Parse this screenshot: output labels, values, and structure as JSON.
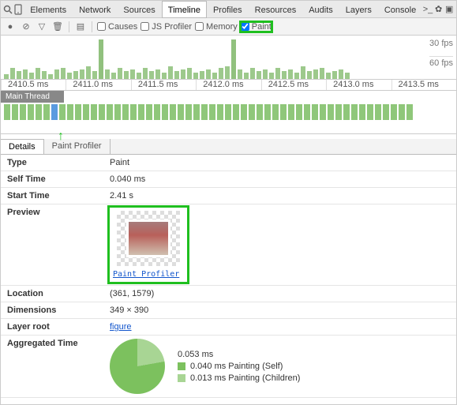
{
  "top_tabs": [
    "Elements",
    "Network",
    "Sources",
    "Timeline",
    "Profiles",
    "Resources",
    "Audits",
    "Layers",
    "Console"
  ],
  "active_top_tab": "Timeline",
  "toolbar": {
    "causes": "Causes",
    "js_profiler": "JS Profiler",
    "memory": "Memory",
    "paint": "Paint"
  },
  "overview": {
    "fps30": "30 fps",
    "fps60": "60 fps",
    "ticks": [
      "2410.5 ms",
      "2411.0 ms",
      "2411.5 ms",
      "2412.0 ms",
      "2412.5 ms",
      "2413.0 ms",
      "2413.5 ms"
    ]
  },
  "main_thread_label": "Main Thread",
  "sub_tabs": {
    "details": "Details",
    "paint_profiler": "Paint Profiler"
  },
  "details": {
    "type_label": "Type",
    "type_value": "Paint",
    "self_time_label": "Self Time",
    "self_time_value": "0.040 ms",
    "start_time_label": "Start Time",
    "start_time_value": "2.41 s",
    "preview_label": "Preview",
    "preview_link": "Paint Profiler",
    "location_label": "Location",
    "location_value": "(361, 1579)",
    "dimensions_label": "Dimensions",
    "dimensions_value": "349 × 390",
    "layer_root_label": "Layer root",
    "layer_root_value": "figure",
    "agg_label": "Aggregated Time"
  },
  "agg": {
    "total": "0.053 ms",
    "self": "0.040 ms Painting (Self)",
    "children": "0.013 ms Painting (Children)",
    "color_self": "#7cc15e",
    "color_children": "#a8d594"
  },
  "chart_data": {
    "type": "pie",
    "title": "Aggregated Time",
    "series": [
      {
        "name": "Painting (Self)",
        "value_ms": 0.04,
        "label": "0.040 ms Painting (Self)"
      },
      {
        "name": "Painting (Children)",
        "value_ms": 0.013,
        "label": "0.013 ms Painting (Children)"
      }
    ],
    "total_ms": 0.053
  }
}
